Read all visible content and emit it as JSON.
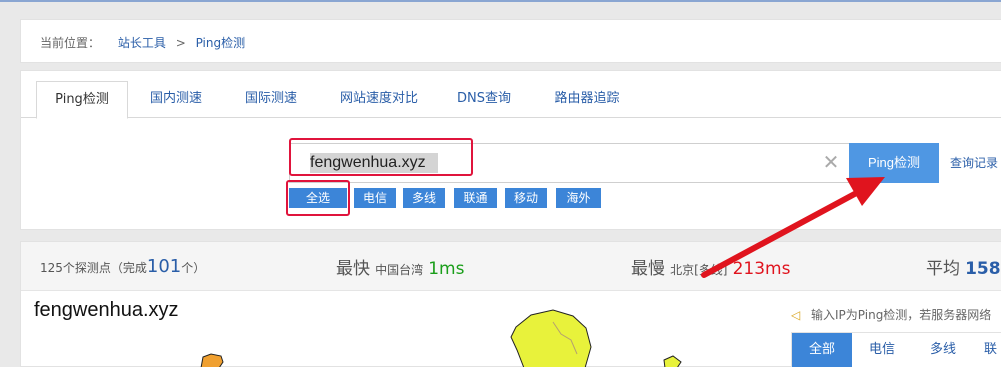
{
  "breadcrumb": {
    "label": "当前位置：",
    "link1": "站长工具",
    "sep": ">",
    "link2": "Ping检测"
  },
  "tabs": [
    {
      "label": "Ping检测",
      "active": true
    },
    {
      "label": "国内测速"
    },
    {
      "label": "国际测速"
    },
    {
      "label": "网站速度对比"
    },
    {
      "label": "DNS查询"
    },
    {
      "label": "路由器追踪"
    }
  ],
  "search": {
    "value": "fengwenhua.xyz",
    "clear_icon": "✕",
    "button": "Ping检测",
    "history": "查询记录"
  },
  "isp_filters": [
    "全选",
    "电信",
    "多线",
    "联通",
    "移动",
    "海外"
  ],
  "stats": {
    "points_prefix": "125个探测点（完成",
    "points_done": "101",
    "points_suffix": "个）",
    "fastest_label": "最快",
    "fastest_loc": "中国台湾",
    "fastest_val": "1ms",
    "slowest_label": "最慢",
    "slowest_loc": "北京[多线]",
    "slowest_val": "213ms",
    "avg_label": "平均",
    "avg_val": "158."
  },
  "result": {
    "domain": "fengwenhua.xyz",
    "notice": "输入IP为Ping检测，若服务器网络",
    "notice_icon": "speaker-icon",
    "filter_tabs": [
      "全部",
      "电信",
      "多线",
      "联"
    ]
  },
  "colors": {
    "accent": "#3c85d8",
    "link": "#2a5ea8",
    "highlight": "#e0143c",
    "fast": "#1a9e1a",
    "slow": "#e0141e",
    "map_fill": "#e8f23b"
  }
}
